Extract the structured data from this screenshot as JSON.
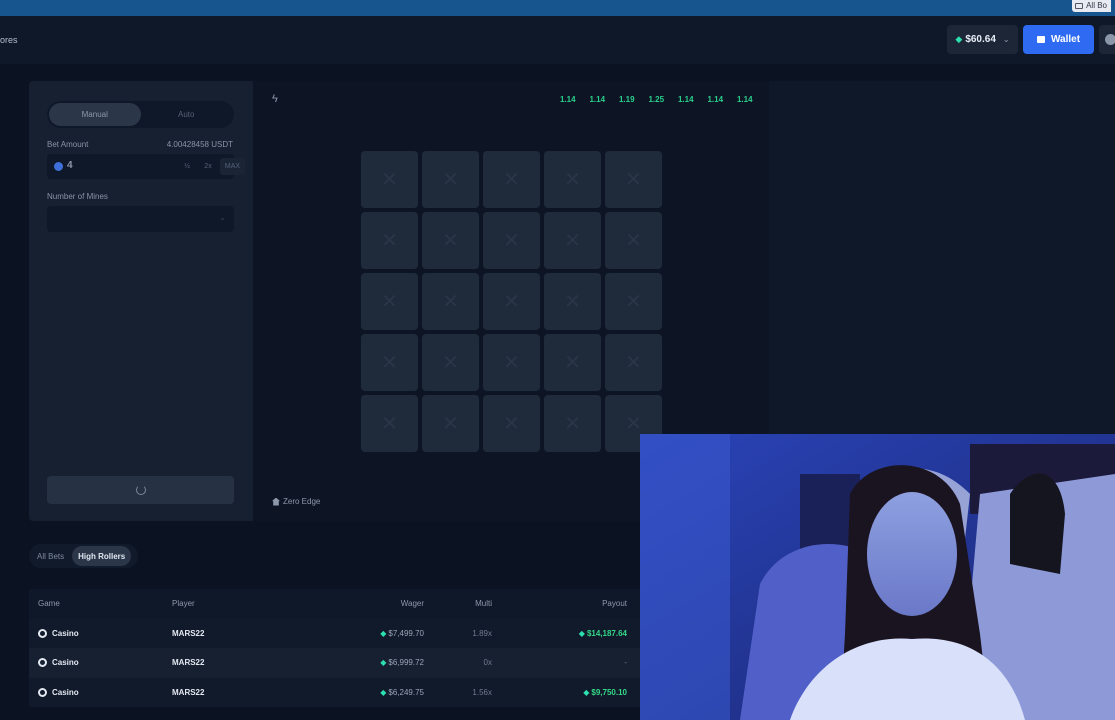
{
  "bookmarks": {
    "all_bookmarks": "All Bo"
  },
  "header": {
    "nav_partial": "ores",
    "balance": "$60.64",
    "wallet_label": "Wallet"
  },
  "bet_panel": {
    "modes": [
      "Manual",
      "Auto"
    ],
    "bet_amount_label": "Bet Amount",
    "bet_usdt": "4.00428458 USDT",
    "bet_value": "4",
    "half": "½",
    "double": "2x",
    "max": "MAX",
    "mines_label": "Number of Mines"
  },
  "game": {
    "multipliers": [
      "1.14",
      "1.14",
      "1.19",
      "1.25",
      "1.14",
      "1.14",
      "1.14"
    ],
    "tile_count": 25,
    "zero_edge": "Zero Edge"
  },
  "bets": {
    "tabs": [
      "All Bets",
      "High Rollers"
    ],
    "active_tab": 1,
    "columns": {
      "game": "Game",
      "player": "Player",
      "wager": "Wager",
      "multi": "Multi",
      "payout": "Payout"
    },
    "rows": [
      {
        "game": "Casino",
        "player": "MARS22",
        "wager": "$7,499.70",
        "multi": "1.89x",
        "payout": "$14,187.64",
        "win": true
      },
      {
        "game": "Casino",
        "player": "MARS22",
        "wager": "$6,999.72",
        "multi": "0x",
        "payout": "-",
        "win": false
      },
      {
        "game": "Casino",
        "player": "MARS22",
        "wager": "$6,249.75",
        "multi": "1.56x",
        "payout": "$9,750.10",
        "win": true
      }
    ]
  },
  "colors": {
    "accent": "#2f6bf2",
    "win": "#34d889",
    "gem": "#2de0b0",
    "background": "#0b1322"
  }
}
